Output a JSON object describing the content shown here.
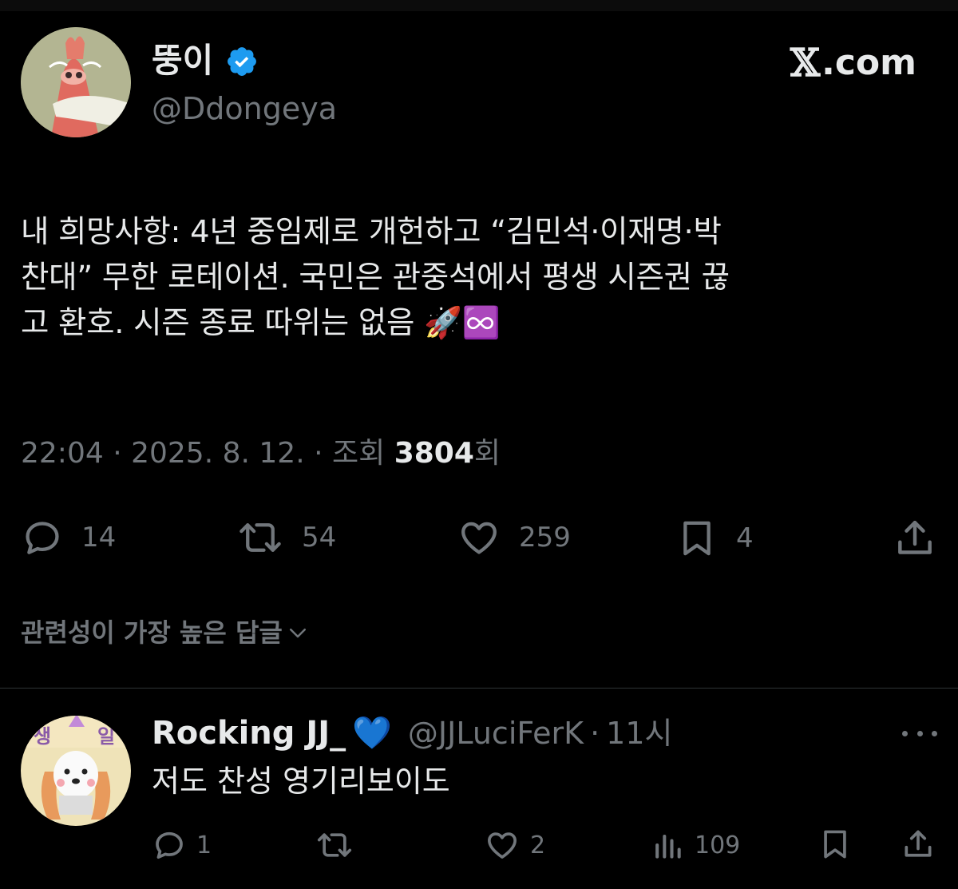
{
  "brand": {
    "logo_mark": "𝕏",
    "logo_text": ".com"
  },
  "tweet": {
    "author_name": "뚱이",
    "verified": true,
    "author_handle": "@Ddongeya",
    "text_lines": [
      "내 희망사항: 4년 중임제로 개헌하고 “김민석·이재명·박",
      "찬대” 무한 로테이션. 국민은 관중석에서 평생 시즌권 끊",
      "고 환호. 시즌 종료 따위는 없음 🚀♾️"
    ],
    "time": "22:04",
    "date": "2025. 8. 12.",
    "views_label": "조회",
    "views_count": "3804",
    "views_suffix": "회",
    "stats": {
      "replies": "14",
      "reposts": "54",
      "likes": "259",
      "bookmarks": "4"
    },
    "icons": [
      "reply-icon",
      "repost-icon",
      "like-icon",
      "bookmark-icon",
      "share-icon"
    ]
  },
  "reply_sort": {
    "label": "관련성이 가장 높은 답글"
  },
  "reply": {
    "author_name": "Rocking JJ_",
    "name_emoji": "💙",
    "author_handle": "@JJLuciFerK",
    "separator": "·",
    "time": "11시",
    "text": "저도 찬성 영기리보이도",
    "stats": {
      "replies": "1",
      "reposts": "",
      "likes": "2",
      "views": "109"
    }
  },
  "colors": {
    "background": "#000000",
    "text_primary": "#e7e9ea",
    "text_secondary": "#71767b",
    "verified_blue": "#1d9bf0",
    "divider": "#2f3336"
  }
}
